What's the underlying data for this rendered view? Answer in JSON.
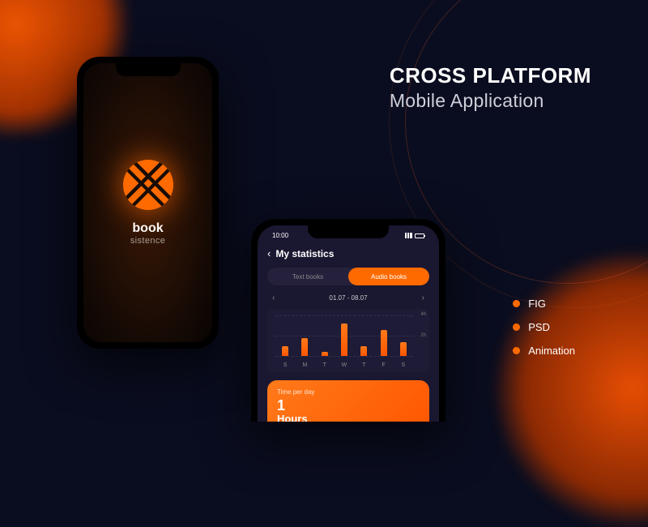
{
  "heading": {
    "line1": "CROSS PLATFORM",
    "line2": "Mobile Application"
  },
  "formats": [
    "FIG",
    "PSD",
    "Animation"
  ],
  "splash": {
    "brand": "book",
    "tagline": "sistence"
  },
  "stats": {
    "time": "10:00",
    "title": "My statistics",
    "tabs": {
      "text": "Text books",
      "audio": "Audio books"
    },
    "date_range": "01.07 - 08.07",
    "time_card": {
      "label": "Time per day",
      "value": "1",
      "unit": "Hours"
    }
  },
  "chart_data": {
    "type": "bar",
    "categories": [
      "S",
      "M",
      "T",
      "W",
      "T",
      "F",
      "S"
    ],
    "values": [
      1.0,
      1.8,
      0.4,
      3.2,
      1.0,
      2.6,
      1.4
    ],
    "ylim": [
      0,
      4
    ],
    "y_ticks": [
      2,
      4
    ],
    "y_tick_labels": [
      "2h",
      "4h"
    ],
    "ylabel": "",
    "xlabel": "",
    "title": ""
  },
  "colors": {
    "accent": "#ff6a00",
    "bg": "#0a0d1f",
    "panel": "#1a1730"
  }
}
